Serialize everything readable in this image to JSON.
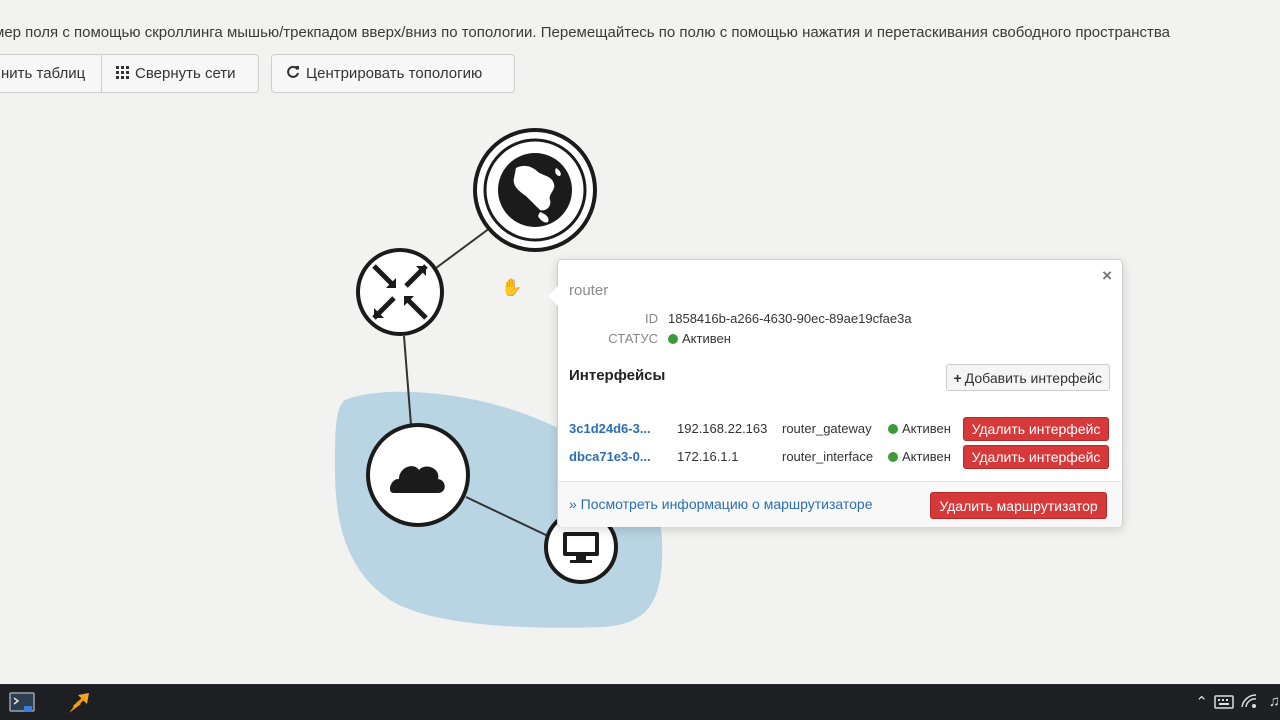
{
  "help_text": "мер поля с помощью скроллинга мышью/трекпадом вверх/вниз по топологии. Перемещайтесь по полю с помощью нажатия и перетаскивания свободного пространства",
  "toolbar": {
    "tables_label": "нить таблиц",
    "collapse_networks_label": "Свернуть сети",
    "center_topology_label": "Центрировать топологию"
  },
  "popup": {
    "title": "router",
    "id_label": "ID",
    "id_value": "1858416b-a266-4630-90ec-89ae19cfae3a",
    "status_label": "СТАТУС",
    "status_value": "Активен",
    "interfaces_title": "Интерфейсы",
    "add_interface_label": "Добавить интерфейс",
    "interfaces": [
      {
        "id": "3c1d24d6-3...",
        "ip": "192.168.22.163",
        "type": "router_gateway",
        "status": "Активен",
        "delete_label": "Удалить интерфейс"
      },
      {
        "id": "dbca71e3-0...",
        "ip": "172.16.1.1",
        "type": "router_interface",
        "status": "Активен",
        "delete_label": "Удалить интерфейс"
      }
    ],
    "view_info_link": "» Посмотреть информацию о маршрутизаторе",
    "delete_router_label": "Удалить маршрутизатор",
    "close_glyph": "×"
  },
  "colors": {
    "accent_link": "#2a6fb4",
    "danger": "#d6393a",
    "status_active": "#3c9a3c",
    "network_region": "#b9d4e2",
    "node_stroke": "#1b1b1b"
  },
  "icons": {
    "globe": "globe-icon",
    "router": "router-icon",
    "cloud": "cloud-icon",
    "monitor": "monitor-icon",
    "grid": "grid-icon",
    "refresh": "refresh-icon"
  }
}
